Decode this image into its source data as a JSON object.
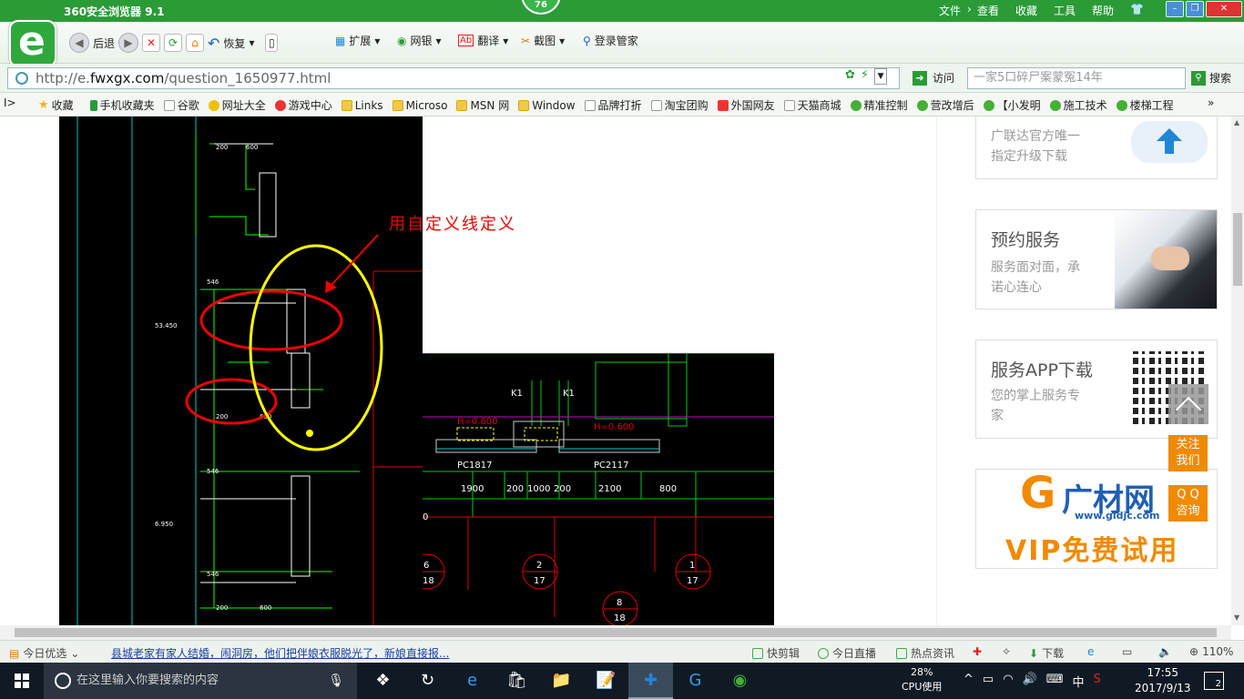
{
  "browser": {
    "title": "360安全浏览器 9.1",
    "score": "76",
    "menus": [
      "文件",
      "查看",
      "收藏",
      "工具",
      "帮助"
    ],
    "toolbar": {
      "back": "后退",
      "restore": "恢复",
      "extend": "扩展",
      "bank": "网银",
      "translate": "翻译",
      "screenshot": "截图",
      "login": "登录管家"
    },
    "address": {
      "url_prefix": "http://e.",
      "url_domain": "fwxgx.com",
      "url_path": "/question_1650977.html",
      "visit_label": "访问",
      "search_placeholder": "一家5口碎尸案蒙冤14年",
      "search_label": "搜索"
    },
    "favorites": [
      "收藏",
      "手机收藏夹",
      "谷歌",
      "网址大全",
      "游戏中心",
      "Links",
      "Microso",
      "MSN 网",
      "Window",
      "品牌打折",
      "淘宝团购",
      "外国网友",
      "天猫商城",
      "精准控制",
      "营改增后",
      "【小发明",
      "施工技术",
      "楼梯工程"
    ]
  },
  "page": {
    "annotation": "用自定义线定义",
    "cad_labels": {
      "k1": "K1",
      "h1": "H=0.600",
      "h2": "H=0.600",
      "pc1": "PC1817",
      "pc2": "PC2117",
      "d1": "1900",
      "d2": "200",
      "d3": "1000",
      "d4": "200",
      "d5": "2100",
      "d6": "800",
      "z0": "0",
      "c6": "6",
      "c18": "18",
      "c2": "2",
      "c17": "17",
      "c8": "8",
      "c18b": "18",
      "c1": "1",
      "c17b": "17",
      "t200": "200",
      "t600": "600",
      "t546": "546",
      "t53": "53.450",
      "t6950": "6.950"
    },
    "sidebar": {
      "card1_line1": "广联达官方唯一",
      "card1_line2": "指定升级下载",
      "card2_title": "预约服务",
      "card2_line1": "服务面对面，承",
      "card2_line2": "诺心连心",
      "card3_title": "服务APP下载",
      "card3_line1": "您的掌上服务专",
      "card3_line2": "家",
      "card4_brand": "广材网",
      "card4_url": "www.gldjc.com",
      "card4_vip": "VIP免费试用"
    },
    "float_follow": [
      "关注",
      "我们"
    ],
    "float_qq": [
      "Q Q",
      "咨询"
    ]
  },
  "statusbar": {
    "today": "今日优选",
    "news": "县城老家有家人结婚，闹洞房，他们把伴娘衣服脱光了，新娘直接报...",
    "clip": "快剪辑",
    "live": "今日直播",
    "hot": "热点资讯",
    "download": "下载",
    "zoom": "110%"
  },
  "taskbar": {
    "search_placeholder": "在这里输入你要搜索的内容",
    "cpu_value": "28%",
    "cpu_label": "CPU使用",
    "ime": "中",
    "time": "17:55",
    "date": "2017/9/13",
    "notifications": "2"
  }
}
